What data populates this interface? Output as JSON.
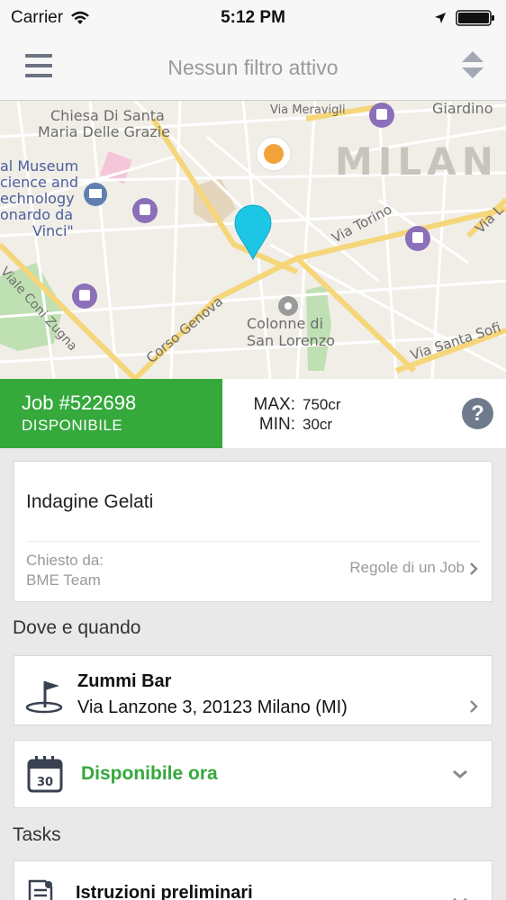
{
  "status_bar": {
    "carrier": "Carrier",
    "time": "5:12 PM"
  },
  "nav": {
    "title": "Nessun filtro attivo"
  },
  "map": {
    "labels": {
      "chiesa1": "Chiesa Di Santa",
      "chiesa2": "Maria Delle Grazie",
      "museum1": "al Museum",
      "museum2": "cience and",
      "museum3": "echnology",
      "museum4": "onardo da",
      "museum5": "Vinci\"",
      "meravigli": "Via Meravigli",
      "giardino": "Giardino",
      "milan": "MILAN",
      "torino": "Via Torino",
      "vial": "Via L",
      "coni_zugna": "Viale Coni Zugna",
      "genova": "Corso Genova",
      "colonne1": "Colonne di",
      "colonne2": "San Lorenzo",
      "santa_sofia": "Via Santa Sofi"
    }
  },
  "job": {
    "number": "Job #522698",
    "status": "DISPONIBILE",
    "max_label": "MAX:",
    "max_value": "750cr",
    "min_label": "MIN:",
    "min_value": "30cr",
    "help": "?"
  },
  "job_card": {
    "title": "Indagine Gelati",
    "asked_label": "Chiesto da:",
    "asked_value": "BME Team",
    "rules_link": "Regole di un Job"
  },
  "where_when": {
    "header": "Dove e quando",
    "place_name": "Zummi Bar",
    "address": "Via Lanzone 3, 20123 Milano (MI)",
    "calendar_day": "30",
    "availability": "Disponibile ora"
  },
  "tasks": {
    "header": "Tasks",
    "items": [
      "Istruzioni preliminari"
    ]
  },
  "colors": {
    "green": "#35a93c",
    "pin": "#1ec6e6",
    "location_dot": "#f2a23a",
    "icon_gray": "#6f7b8c"
  }
}
